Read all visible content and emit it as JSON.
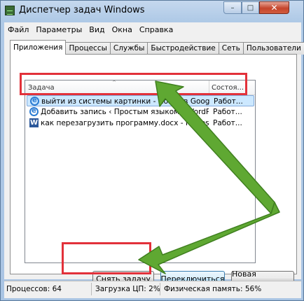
{
  "window": {
    "title": "Диспетчер задач Windows",
    "min": "–",
    "max": "□",
    "close": "✕"
  },
  "menu": [
    "Файл",
    "Параметры",
    "Вид",
    "Окна",
    "Справка"
  ],
  "tabs": [
    "Приложения",
    "Процессы",
    "Службы",
    "Быстродействие",
    "Сеть",
    "Пользователи"
  ],
  "list": {
    "columns": {
      "task": "Задача",
      "status": "Состоя..."
    },
    "rows": [
      {
        "icon": "ie-icon",
        "name": "выйти из системы картинки - Поиск в Google ...",
        "status": "Работ..."
      },
      {
        "icon": "ie-icon",
        "name": "Добавить запись ‹ Простым языком ‹ WordPress",
        "status": "Работ..."
      },
      {
        "icon": "word-icon",
        "name": "как перезагрузить программу.docx - Microsoft Word",
        "status": "Работ..."
      }
    ]
  },
  "buttons": {
    "end_task": "Снять задачу",
    "switch_to": "Переключиться",
    "new_task": "Новая задача..."
  },
  "status": {
    "processes": "Процессов: 64",
    "cpu": "Загрузка ЦП: 2%",
    "memory": "Физическая память: 56%"
  },
  "colors": {
    "highlight": "#e2313a",
    "arrow": "#5fa832"
  }
}
